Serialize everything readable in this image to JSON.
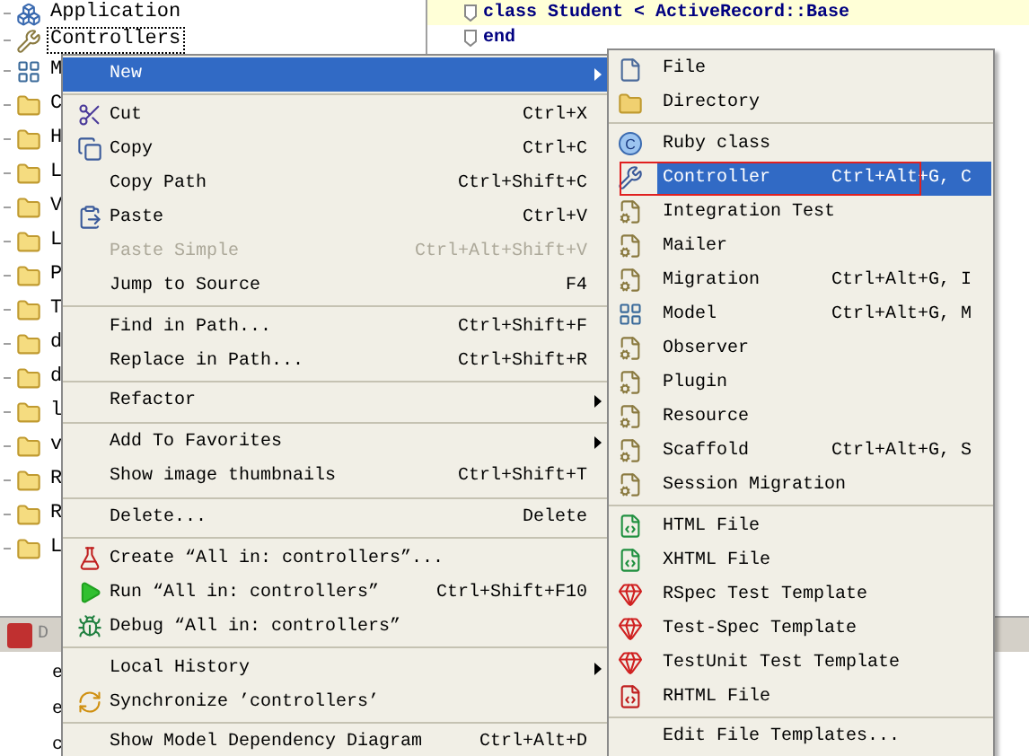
{
  "project_tree": {
    "items": [
      {
        "label": "Application",
        "selected": false
      },
      {
        "label": "Controllers",
        "selected": true
      },
      {
        "label": "M",
        "selected": false
      },
      {
        "label": "C",
        "selected": false
      },
      {
        "label": "H",
        "selected": false
      },
      {
        "label": "L",
        "selected": false
      },
      {
        "label": "V",
        "selected": false
      },
      {
        "label": "L",
        "selected": false
      },
      {
        "label": "P",
        "selected": false
      },
      {
        "label": "T",
        "selected": false
      },
      {
        "label": "d",
        "selected": false
      },
      {
        "label": "d",
        "selected": false
      },
      {
        "label": "l",
        "selected": false
      },
      {
        "label": "v",
        "selected": false
      },
      {
        "label": "R",
        "selected": false
      },
      {
        "label": "R",
        "selected": false
      },
      {
        "label": "L",
        "selected": false
      }
    ]
  },
  "editor": {
    "lines": [
      "class Student < ActiveRecord::Base",
      "end"
    ]
  },
  "bottom_panel": {
    "title": "D",
    "lines": [
      "e",
      "e",
      "c"
    ]
  },
  "context_menu": {
    "items": [
      {
        "kind": "item",
        "label": "New",
        "has_submenu": true,
        "disabled": false,
        "selected": true
      },
      {
        "kind": "separator"
      },
      {
        "kind": "item",
        "label": "Cut",
        "shortcut": "Ctrl+X",
        "has_submenu": false,
        "disabled": false,
        "selected": false
      },
      {
        "kind": "item",
        "label": "Copy",
        "shortcut": "Ctrl+C",
        "has_submenu": false,
        "disabled": false,
        "selected": false
      },
      {
        "kind": "item",
        "label": "Copy Path",
        "shortcut": "Ctrl+Shift+C",
        "has_submenu": false,
        "disabled": false,
        "selected": false
      },
      {
        "kind": "item",
        "label": "Paste",
        "shortcut": "Ctrl+V",
        "has_submenu": false,
        "disabled": false,
        "selected": false
      },
      {
        "kind": "item",
        "label": "Paste Simple",
        "shortcut": "Ctrl+Alt+Shift+V",
        "has_submenu": false,
        "disabled": true,
        "selected": false
      },
      {
        "kind": "item",
        "label": "Jump to Source",
        "shortcut": "F4",
        "has_submenu": false,
        "disabled": false,
        "selected": false
      },
      {
        "kind": "separator"
      },
      {
        "kind": "item",
        "label": "Find in Path...",
        "shortcut": "Ctrl+Shift+F",
        "has_submenu": false,
        "disabled": false,
        "selected": false
      },
      {
        "kind": "item",
        "label": "Replace in Path...",
        "shortcut": "Ctrl+Shift+R",
        "has_submenu": false,
        "disabled": false,
        "selected": false
      },
      {
        "kind": "separator"
      },
      {
        "kind": "item",
        "label": "Refactor",
        "has_submenu": true,
        "disabled": false,
        "selected": false
      },
      {
        "kind": "separator"
      },
      {
        "kind": "item",
        "label": "Add To Favorites",
        "has_submenu": true,
        "disabled": false,
        "selected": false
      },
      {
        "kind": "item",
        "label": "Show image thumbnails",
        "shortcut": "Ctrl+Shift+T",
        "has_submenu": false,
        "disabled": false,
        "selected": false
      },
      {
        "kind": "separator"
      },
      {
        "kind": "item",
        "label": "Delete...",
        "shortcut": "Delete",
        "has_submenu": false,
        "disabled": false,
        "selected": false
      },
      {
        "kind": "separator"
      },
      {
        "kind": "item",
        "label": "Create “All in: controllers”...",
        "has_submenu": false,
        "disabled": false,
        "selected": false
      },
      {
        "kind": "item",
        "label": "Run “All in: controllers”",
        "shortcut": "Ctrl+Shift+F10",
        "has_submenu": false,
        "disabled": false,
        "selected": false
      },
      {
        "kind": "item",
        "label": "Debug “All in: controllers”",
        "has_submenu": false,
        "disabled": false,
        "selected": false
      },
      {
        "kind": "separator"
      },
      {
        "kind": "item",
        "label": "Local History",
        "has_submenu": true,
        "disabled": false,
        "selected": false
      },
      {
        "kind": "item",
        "label": "Synchronize ’controllers’",
        "has_submenu": false,
        "disabled": false,
        "selected": false
      },
      {
        "kind": "separator"
      },
      {
        "kind": "item",
        "label": "Show Model Dependency Diagram",
        "shortcut": "Ctrl+Alt+D",
        "has_submenu": false,
        "disabled": false,
        "selected": false
      }
    ]
  },
  "new_submenu": {
    "items": [
      {
        "kind": "item",
        "label": "File",
        "selected": false,
        "outlined": false
      },
      {
        "kind": "item",
        "label": "Directory",
        "selected": false,
        "outlined": false
      },
      {
        "kind": "separator"
      },
      {
        "kind": "item",
        "label": "Ruby class",
        "icon_letter": "C",
        "selected": false,
        "outlined": false
      },
      {
        "kind": "item",
        "label": "Controller",
        "shortcut": "Ctrl+Alt+G, C",
        "selected": true,
        "outlined": true
      },
      {
        "kind": "item",
        "label": "Integration Test",
        "selected": false,
        "outlined": false
      },
      {
        "kind": "item",
        "label": "Mailer",
        "selected": false,
        "outlined": false
      },
      {
        "kind": "item",
        "label": "Migration",
        "shortcut": "Ctrl+Alt+G, I",
        "selected": false,
        "outlined": false
      },
      {
        "kind": "item",
        "label": "Model",
        "shortcut": "Ctrl+Alt+G, M",
        "selected": false,
        "outlined": false
      },
      {
        "kind": "item",
        "label": "Observer",
        "selected": false,
        "outlined": false
      },
      {
        "kind": "item",
        "label": "Plugin",
        "selected": false,
        "outlined": false
      },
      {
        "kind": "item",
        "label": "Resource",
        "selected": false,
        "outlined": false
      },
      {
        "kind": "item",
        "label": "Scaffold",
        "shortcut": "Ctrl+Alt+G, S",
        "selected": false,
        "outlined": false
      },
      {
        "kind": "item",
        "label": "Session Migration",
        "selected": false,
        "outlined": false
      },
      {
        "kind": "separator"
      },
      {
        "kind": "item",
        "label": "HTML File",
        "selected": false,
        "outlined": false
      },
      {
        "kind": "item",
        "label": "XHTML File",
        "selected": false,
        "outlined": false
      },
      {
        "kind": "item",
        "label": "RSpec Test Template",
        "selected": false,
        "outlined": false
      },
      {
        "kind": "item",
        "label": "Test-Spec Template",
        "selected": false,
        "outlined": false
      },
      {
        "kind": "item",
        "label": "TestUnit Test Template",
        "selected": false,
        "outlined": false
      },
      {
        "kind": "item",
        "label": "RHTML File",
        "selected": false,
        "outlined": false
      },
      {
        "kind": "separator"
      },
      {
        "kind": "item",
        "label": "Edit File Templates...",
        "selected": false,
        "outlined": false
      }
    ]
  }
}
